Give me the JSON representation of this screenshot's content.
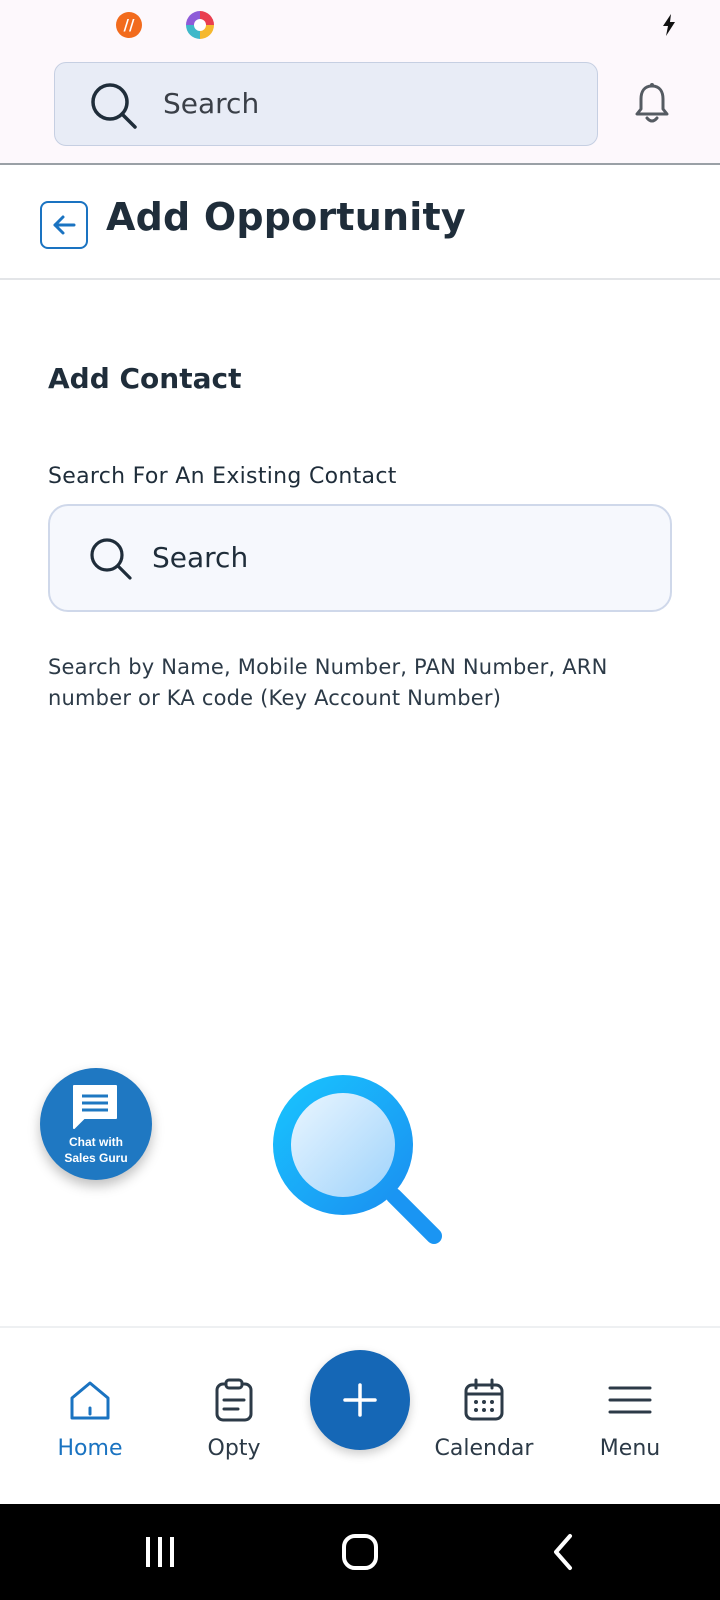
{
  "header": {
    "search_placeholder": "Search"
  },
  "page": {
    "title": "Add Opportunity"
  },
  "form": {
    "section_heading": "Add Contact",
    "search_label": "Search For An Existing Contact",
    "search_placeholder": "Search",
    "helper_text": "Search by Name, Mobile Number, PAN Number, ARN number or KA code (Key Account Number)"
  },
  "chat": {
    "label": "Chat with\nSales Guru"
  },
  "bottom_nav": {
    "items": [
      {
        "label": "Home",
        "icon": "home-icon",
        "active": true
      },
      {
        "label": "Opty",
        "icon": "clipboard-icon",
        "active": false
      },
      {
        "label": "Calendar",
        "icon": "calendar-icon",
        "active": false
      },
      {
        "label": "Menu",
        "icon": "menu-icon",
        "active": false
      }
    ],
    "fab_icon": "plus-icon"
  },
  "colors": {
    "accent": "#1a73c1",
    "fab": "#1567b6",
    "chat_bubble": "#1f78c2",
    "text_primary": "#1f2d3a"
  }
}
